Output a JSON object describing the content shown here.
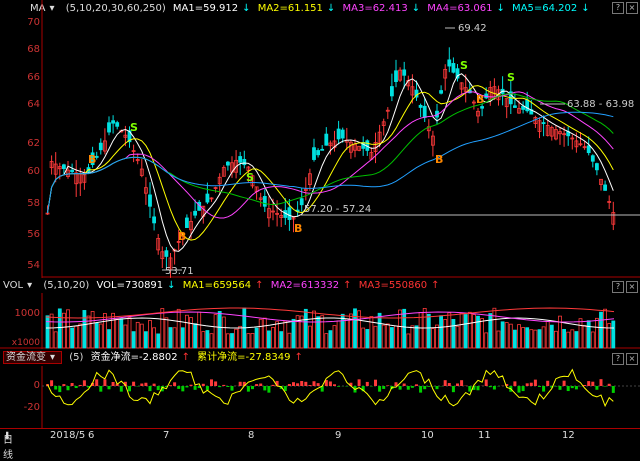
{
  "main_header": {
    "indicator": "MA",
    "params": "(5,10,20,30,60,250)",
    "ma1": "MA1=59.912",
    "ma2": "MA2=61.151",
    "ma3": "MA3=62.413",
    "ma4": "MA4=63.061",
    "ma5": "MA5=64.202",
    "arrow": "↓"
  },
  "price_axis": [
    "70",
    "68",
    "66",
    "64",
    "62",
    "60",
    "58",
    "56",
    "54"
  ],
  "annotations": {
    "high": "69.42",
    "low": "53.71",
    "range1": "57.20 - 57.24",
    "range2": "63.88 - 63.98"
  },
  "signals": {
    "buy": "B",
    "sell": "S"
  },
  "vol_header": {
    "indicator": "VOL",
    "params": "(5,10,20)",
    "vol": "VOL=730891",
    "ma1": "MA1=659564",
    "ma2": "MA2=613332",
    "ma3": "MA3=550860",
    "up": "↑",
    "down": "↓"
  },
  "vol_axis": {
    "top": "1000",
    "unit": "x1000"
  },
  "fund_header": {
    "indicator": "资金流变",
    "params": "(5)",
    "net": "资金净流=-2.8802",
    "cum": "累计净流=-27.8349",
    "up": "↑"
  },
  "fund_axis": [
    "0",
    "-20"
  ],
  "bottom": {
    "period": "日线",
    "dates": [
      "2018/5",
      "6",
      "7",
      "8",
      "9",
      "10",
      "11",
      "12"
    ]
  },
  "colors": {
    "up": "#ff3a3a",
    "down": "#00e0e0",
    "ma5": "#ffffff",
    "ma10": "#ffff00",
    "ma20": "#ff44ff",
    "ma30": "#00c000",
    "ma60": "#ff8800",
    "ma250": "#22a0ff"
  }
}
